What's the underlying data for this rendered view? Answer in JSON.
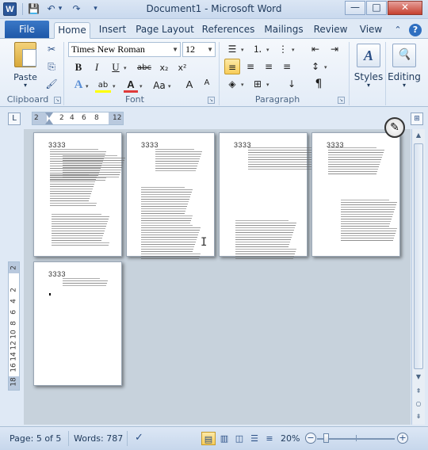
{
  "window": {
    "title": "Document1  -  Microsoft Word",
    "app_icon": "W",
    "minimize": "—",
    "maximize": "□",
    "close": "✕"
  },
  "quick_access": {
    "save_icon": "💾",
    "undo_icon": "↶",
    "redo_icon": "↷",
    "customize_icon": "▾"
  },
  "tabs": {
    "file": "File",
    "items": [
      "Home",
      "Insert",
      "Page Layout",
      "References",
      "Mailings",
      "Review",
      "View"
    ],
    "active": "Home",
    "minimize_ribbon_icon": "⌃",
    "help_icon": "?"
  },
  "ribbon": {
    "clipboard": {
      "label": "Clipboard",
      "paste_label": "Paste",
      "cut_icon": "✂",
      "copy_icon": "⎘",
      "format_painter_icon": "🖌"
    },
    "font": {
      "label": "Font",
      "font_name": "Times New Roman",
      "font_size": "12",
      "grow_icon": "A",
      "shrink_icon": "A",
      "bold": "B",
      "italic": "I",
      "underline": "U",
      "strike": "abc",
      "subscript": "x₂",
      "superscript": "x²",
      "text_effects": "A",
      "highlight": "ab",
      "font_color": "A",
      "change_case": "Aa",
      "clear_format": "A",
      "highlight_color": "#ffff00",
      "font_color_value": "#e03a3a"
    },
    "paragraph": {
      "label": "Paragraph",
      "bullets_icon": "☰",
      "numbering_icon": "⒈",
      "multilevel_icon": "⋮",
      "decrease_indent_icon": "⇤",
      "increase_indent_icon": "⇥",
      "align_left_icon": "≡",
      "center_icon": "≡",
      "align_right_icon": "≡",
      "justify_icon": "≡",
      "line_spacing_icon": "↕",
      "shading_icon": "◈",
      "borders_icon": "⊞",
      "sort_icon": "↓",
      "pilcrow_icon": "¶"
    },
    "styles": {
      "label": "Styles",
      "icon": "A"
    },
    "editing": {
      "label": "Editing",
      "icon": "🔍"
    }
  },
  "rulers": {
    "tab_selector": "L",
    "horizontal_ticks": [
      "2",
      "2",
      "4",
      "6",
      "8",
      "12"
    ],
    "vertical_ticks": [
      "2",
      "2",
      "4",
      "6",
      "8",
      "10",
      "12",
      "14",
      "16",
      "18"
    ],
    "view_ruler_icon": "⊞"
  },
  "pages": {
    "header_text": "3333"
  },
  "scrollbar": {
    "up": "▲",
    "down": "▼",
    "prev_page": "⇞",
    "select_browse": "○",
    "next_page": "⇟"
  },
  "statusbar": {
    "page": "Page: 5 of 5",
    "words": "Words: 787",
    "proofing_icon": "✓",
    "zoom": "20%",
    "zoom_out": "−",
    "zoom_in": "+",
    "views": [
      "print-layout",
      "full-screen-reading",
      "web-layout",
      "outline",
      "draft"
    ],
    "active_view": "print-layout",
    "zoom_level_percent": 20
  }
}
